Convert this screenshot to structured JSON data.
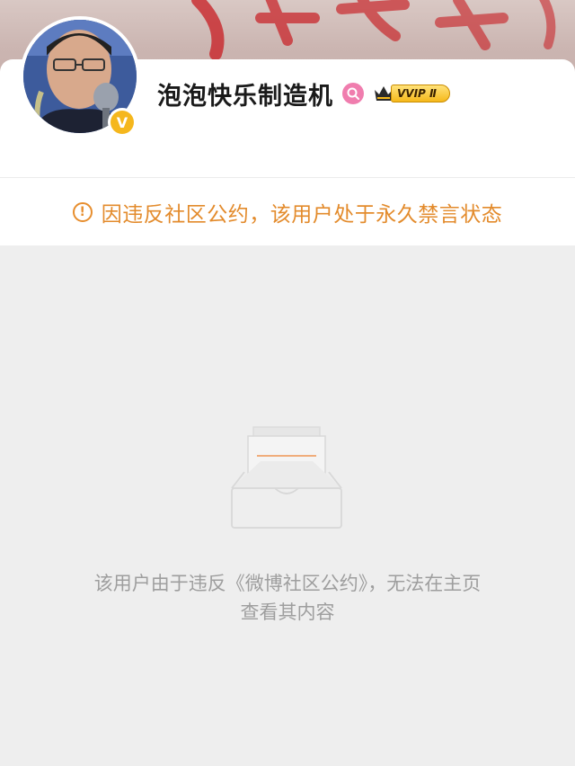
{
  "profile": {
    "username": "泡泡快乐制造机",
    "verified_badge_symbol": "V",
    "vip_label": "VVIP Ⅱ",
    "icons": {
      "avatar": "avatar",
      "verified": "verified-v-icon",
      "search": "super-topic-search-icon",
      "crown": "vip-crown-icon"
    }
  },
  "notice": {
    "icon": "!",
    "text": "因违反社区公约，该用户处于永久禁言状态"
  },
  "empty_state": {
    "line1": "该用户由于违反《微博社区公约》，无法在主页",
    "line2": "查看其内容"
  },
  "colors": {
    "notice": "#e38b2c",
    "verified": "#f5b71d",
    "empty_text": "#9e9e9e",
    "accent_line": "#f0a36a"
  }
}
